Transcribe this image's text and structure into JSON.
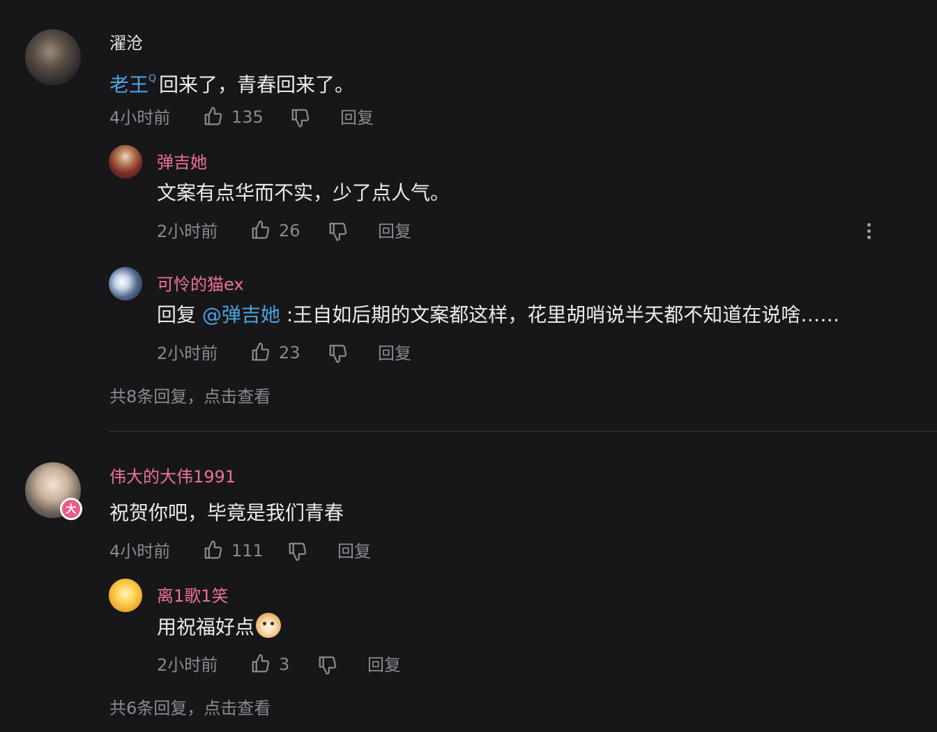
{
  "comments": [
    {
      "username": "濯沧",
      "text_link": "老王",
      "text_link_marker": "Q",
      "text": "回来了，青春回来了。",
      "time": "4小时前",
      "likes": "135",
      "reply_label": "回复",
      "replies": [
        {
          "username": "弹吉她",
          "text": "文案有点华而不实，少了点人气。",
          "time": "2小时前",
          "likes": "26",
          "reply_label": "回复"
        },
        {
          "username": "可怜的猫ex",
          "reply_prefix": "回复",
          "mention": "@弹吉她",
          "text": ":王自如后期的文案都这样，花里胡哨说半天都不知道在说啥……",
          "time": "2小时前",
          "likes": "23",
          "reply_label": "回复"
        }
      ],
      "view_more": "共8条回复，点击查看"
    },
    {
      "username": "伟大的大伟1991",
      "badge": "大",
      "text": "祝贺你吧，毕竟是我们青春",
      "time": "4小时前",
      "likes": "111",
      "reply_label": "回复",
      "replies": [
        {
          "username": "离1歌1笑",
          "text": "用祝福好点",
          "emoji": "doge-emoji",
          "time": "2小时前",
          "likes": "3",
          "reply_label": "回复"
        }
      ],
      "view_more": "共6条回复，点击查看"
    }
  ],
  "icons": {
    "like": "thumbs-up-icon",
    "dislike": "thumbs-down-icon",
    "more": "more-vertical-icon"
  },
  "colors": {
    "background": "#17171a",
    "username_pink": "#f0709a",
    "link_blue": "#4ba3e0",
    "meta_gray": "#8a8a90"
  }
}
